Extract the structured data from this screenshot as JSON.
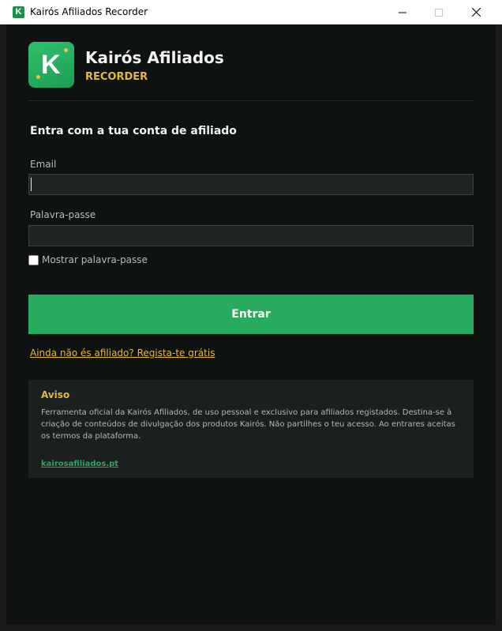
{
  "window": {
    "title": "Kairós Afiliados Recorder",
    "icon_letter": "K"
  },
  "brand": {
    "logo_letter": "K",
    "name": "Kairós Afiliados",
    "subtitle": "RECORDER",
    "accent_color": "#27ab5e",
    "highlight_color": "#e8b73a"
  },
  "login": {
    "heading": "Entra com a tua conta de afiliado",
    "email_label": "Email",
    "email_value": "",
    "password_label": "Palavra-passe",
    "password_value": "",
    "show_password_label": "Mostrar palavra-passe",
    "show_password_checked": false,
    "submit_label": "Entrar",
    "signup_link": "Ainda não és afiliado? Regista-te grátis"
  },
  "notice": {
    "title": "Aviso",
    "text": "Ferramenta oficial da Kairós Afiliados, de uso pessoal e exclusivo para afiliados registados. Destina-se à criação de conteúdos de divulgação dos produtos Kairós. Não partilhes o teu acesso. Ao entrares aceitas os termos da plataforma.",
    "link": "kairosafiliados.pt"
  }
}
